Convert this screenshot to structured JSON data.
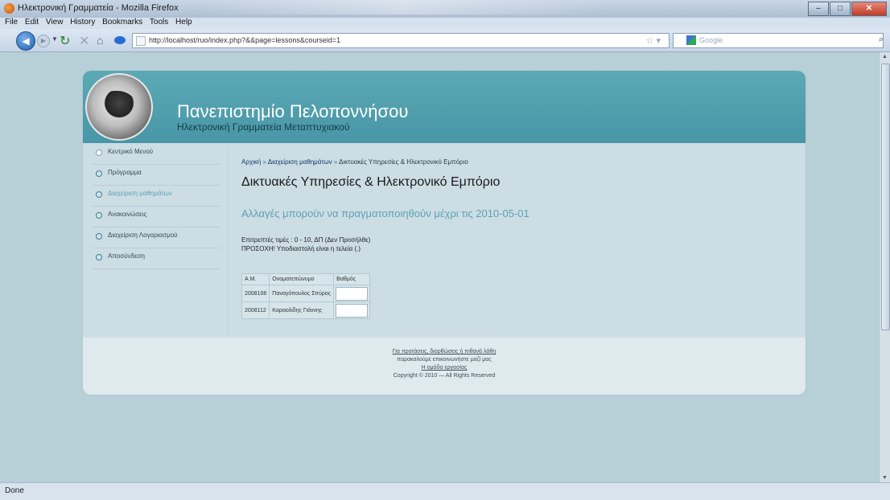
{
  "window": {
    "title": "Ηλεκτρονική Γραμματεία - Mozilla Firefox"
  },
  "menubar": {
    "items": [
      "File",
      "Edit",
      "View",
      "History",
      "Bookmarks",
      "Tools",
      "Help"
    ]
  },
  "toolbar": {
    "url": "http://localhost/ruo/index.php?&&page=lessons&courseid=1",
    "search_placeholder": "Google"
  },
  "status": {
    "text": "Done"
  },
  "site": {
    "title": "Πανεπιστημίο Πελοποννήσου",
    "subtitle": "Ηλεκτρονική Γραμματεία Μεταπτυχιακού"
  },
  "sidebar": {
    "items": [
      {
        "label": "Κεντρικό Μενού"
      },
      {
        "label": "Πρόγραμμα"
      },
      {
        "label": "Διαχείριση μαθημάτων"
      },
      {
        "label": "Ανακοινώσεις"
      },
      {
        "label": "Διαχείριση Λογαριασμού"
      },
      {
        "label": "Αποσύνδεση"
      }
    ]
  },
  "breadcrumb": {
    "home": "Αρχική",
    "sep": "»",
    "courses": "Διαχείριση μαθημάτων",
    "current": "Δικτυακές Υπηρεσίες & Ηλεκτρονικό Εμπόριο"
  },
  "content": {
    "title": "Δικτυακές Υπηρεσίες & Ηλεκτρονικό Εμπόριο",
    "deadline": "Αλλαγές μπορούν να πραγματοποιηθούν μέχρι τις 2010-05-01",
    "info1": "Επιτρεπτές τιμές : 0 - 10, ΔΠ (Δεν Προσήλθε)",
    "info2": "ΠΡΟΣΟΧΗ! Υποδιαστολή είναι η τελεία (.)"
  },
  "grades_table": {
    "headers": {
      "am": "Α.Μ.",
      "name": "Ονοματεπώνυμο",
      "grade": "Βαθμός"
    },
    "rows": [
      {
        "am": "2008108",
        "name": "Παναγόπουλος Σπύρος",
        "grade": ""
      },
      {
        "am": "2008112",
        "name": "Καραολίδης Γιάννης",
        "grade": ""
      }
    ]
  },
  "footer": {
    "line1": "Για προτάσεις, διορθώσεις ή πιθανά λάθη",
    "line2": "παρακαλούμε επικοινωνήστε μαζί μας",
    "line3": "Η ομάδα εργασίας",
    "copyright": "Copyright © 2010 — All Rights Reserved"
  }
}
